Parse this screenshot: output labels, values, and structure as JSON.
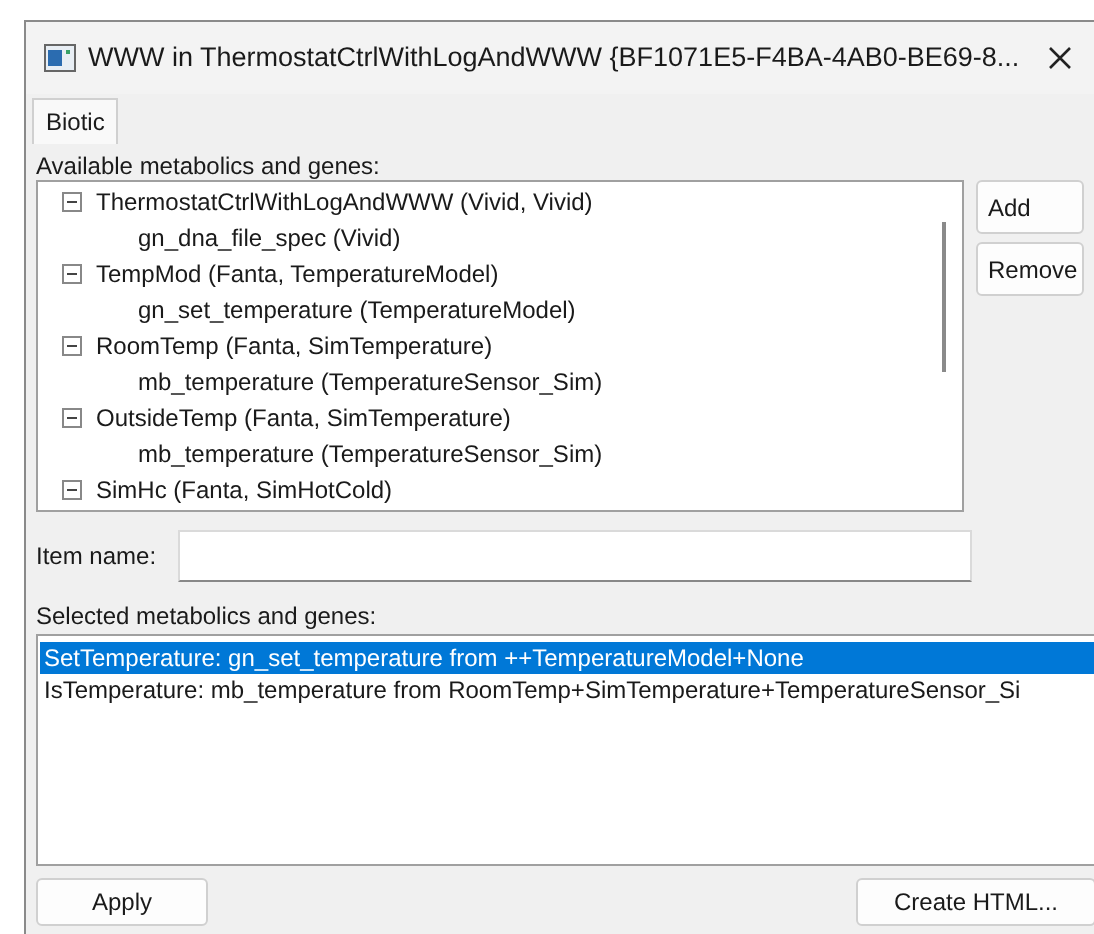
{
  "window": {
    "title": "WWW in ThermostatCtrlWithLogAndWWW {BF1071E5-F4BA-4AB0-BE69-8..."
  },
  "tabs": [
    {
      "label": "Biotic",
      "selected": true
    }
  ],
  "available": {
    "label": "Available metabolics and genes:",
    "items": [
      {
        "label": "ThermostatCtrlWithLogAndWWW (Vivid, Vivid)",
        "expanded": true,
        "children": [
          {
            "label": "gn_dna_file_spec (Vivid)"
          }
        ]
      },
      {
        "label": "TempMod (Fanta, TemperatureModel)",
        "expanded": true,
        "children": [
          {
            "label": "gn_set_temperature (TemperatureModel)"
          }
        ]
      },
      {
        "label": "RoomTemp (Fanta, SimTemperature)",
        "expanded": true,
        "children": [
          {
            "label": "mb_temperature (TemperatureSensor_Sim)"
          }
        ]
      },
      {
        "label": "OutsideTemp (Fanta, SimTemperature)",
        "expanded": true,
        "children": [
          {
            "label": "mb_temperature (TemperatureSensor_Sim)"
          }
        ]
      },
      {
        "label": "SimHc (Fanta, SimHotCold)",
        "expanded": true
      }
    ]
  },
  "side_buttons": [
    "Add",
    "Remove"
  ],
  "item_name": {
    "label": "Item name:"
  },
  "selected_list": {
    "label": "Selected metabolics and genes:",
    "items": [
      {
        "label": "SetTemperature: gn_set_temperature from ++TemperatureModel+None",
        "selected": true
      },
      {
        "label": "IsTemperature: mb_temperature from RoomTemp+SimTemperature+TemperatureSensor_Si",
        "selected": false
      }
    ]
  },
  "bottom_buttons": [
    "Apply",
    "Create HTML..."
  ]
}
